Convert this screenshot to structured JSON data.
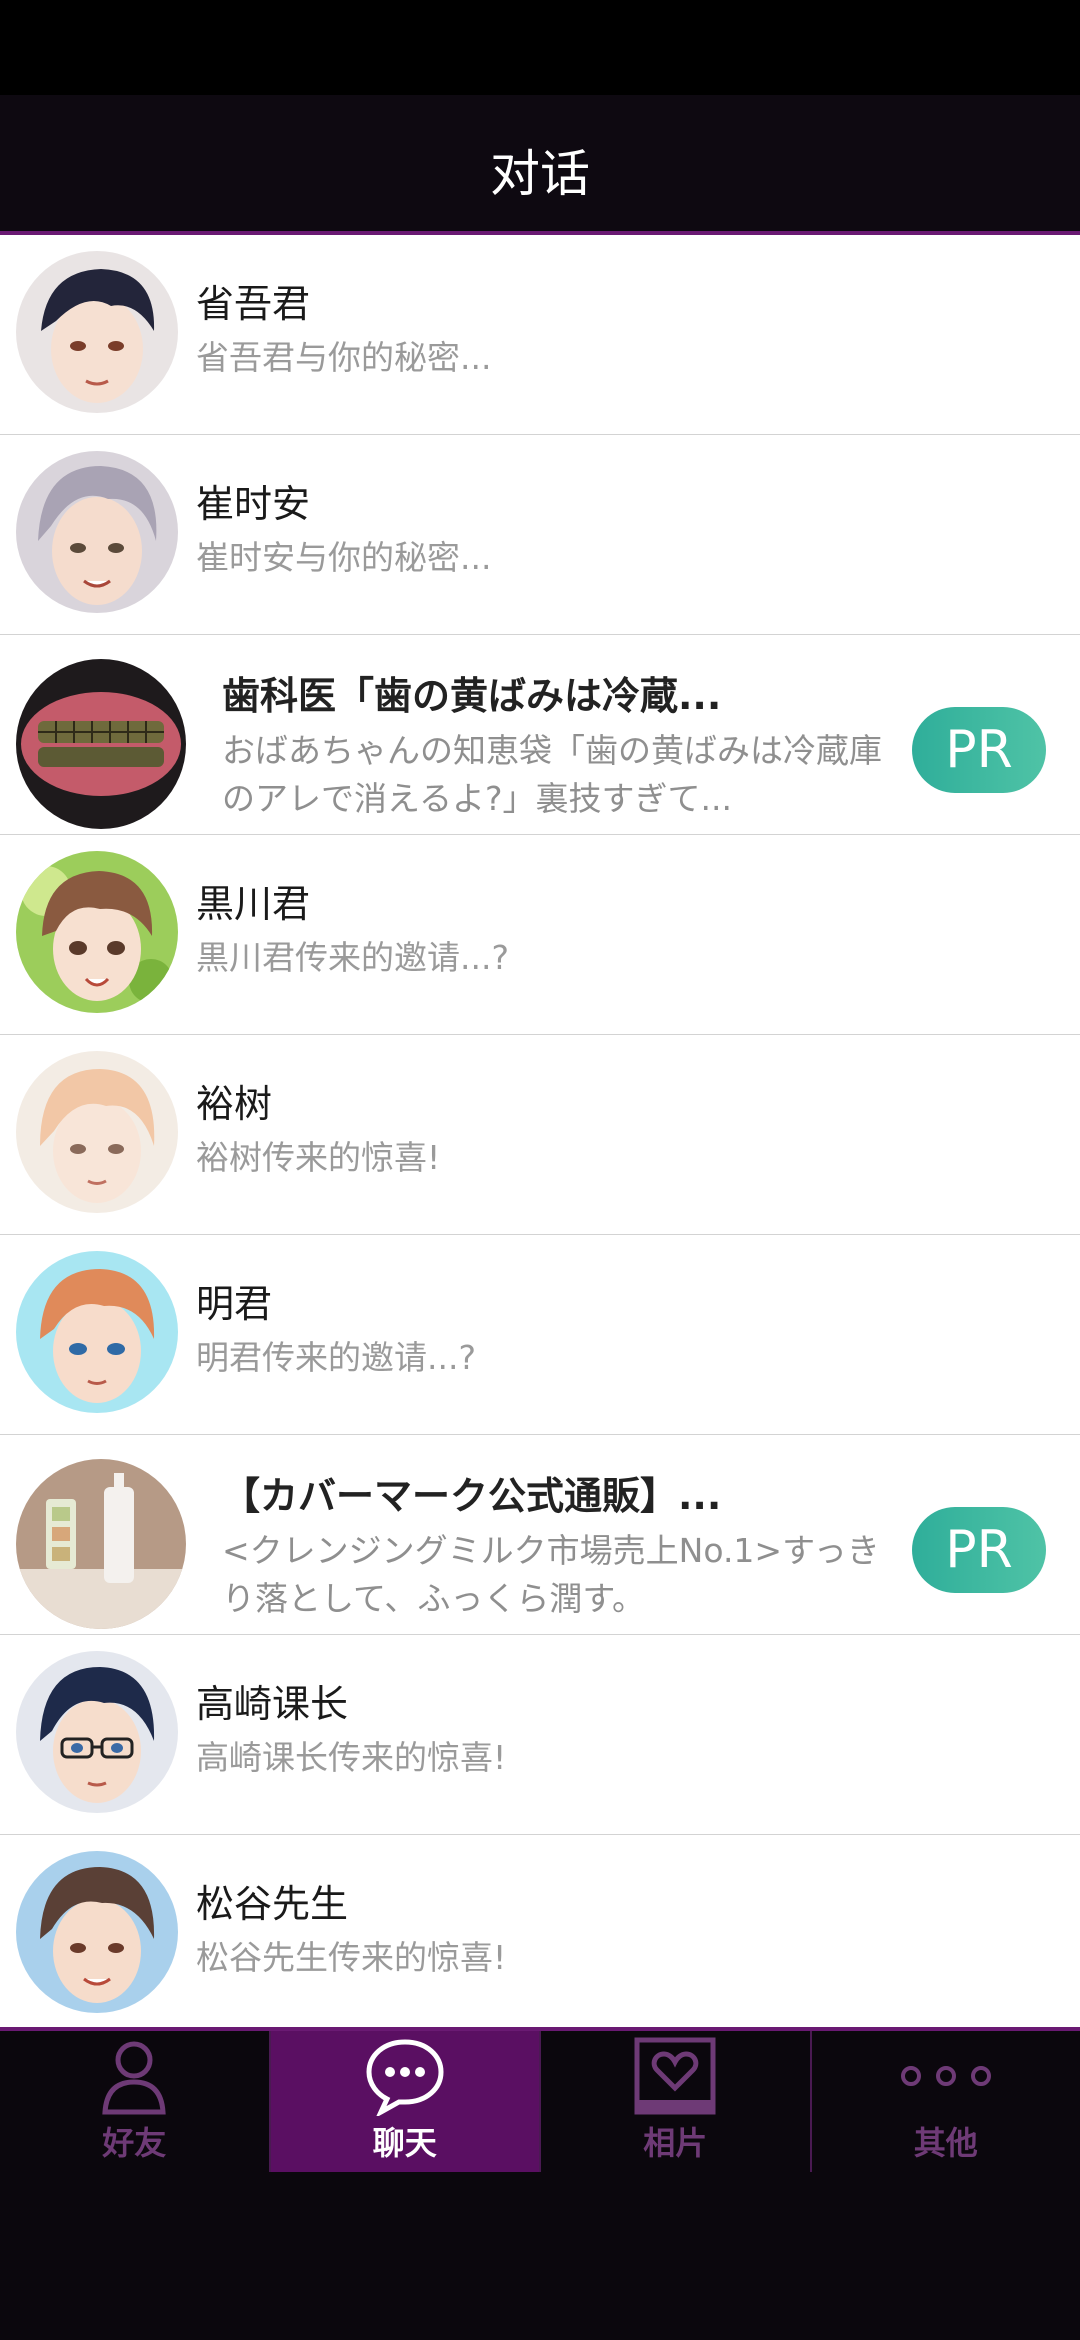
{
  "header": {
    "title": "对话"
  },
  "chats": [
    {
      "name": "省吾君",
      "preview": "省吾君与你的秘密..."
    },
    {
      "name": "崔时安",
      "preview": "崔时安与你的秘密..."
    },
    {
      "name": "黒川君",
      "preview": "黒川君传来的邀请...?"
    },
    {
      "name": "裕树",
      "preview": "裕树传来的惊喜!"
    },
    {
      "name": "明君",
      "preview": "明君传来的邀请...?"
    },
    {
      "name": "高崎课长",
      "preview": "高崎课长传来的惊喜!"
    },
    {
      "name": "松谷先生",
      "preview": "松谷先生传来的惊喜!"
    }
  ],
  "ads": [
    {
      "title": "歯科医「歯の黄ばみは冷蔵...",
      "desc": "おばあちゃんの知恵袋「歯の黄ばみは冷蔵庫のアレで消えるよ?」裏技すぎて...",
      "badge": "PR"
    },
    {
      "title": "【カバーマーク公式通販】...",
      "desc": "<クレンジングミルク市場売上No.1>すっきり落として、ふっくら潤す。",
      "badge": "PR"
    }
  ],
  "tabs": [
    {
      "label": "好友",
      "icon": "person-icon",
      "active": false
    },
    {
      "label": "聊天",
      "icon": "chat-bubble-icon",
      "active": true
    },
    {
      "label": "相片",
      "icon": "photo-heart-icon",
      "active": false
    },
    {
      "label": "其他",
      "icon": "more-dots-icon",
      "active": false
    }
  ],
  "colors": {
    "header_bg": "#0e0911",
    "accent_purple": "#6a1a73",
    "active_tab_bg": "#5a0f62",
    "pr_badge": "#3fb8a0"
  }
}
